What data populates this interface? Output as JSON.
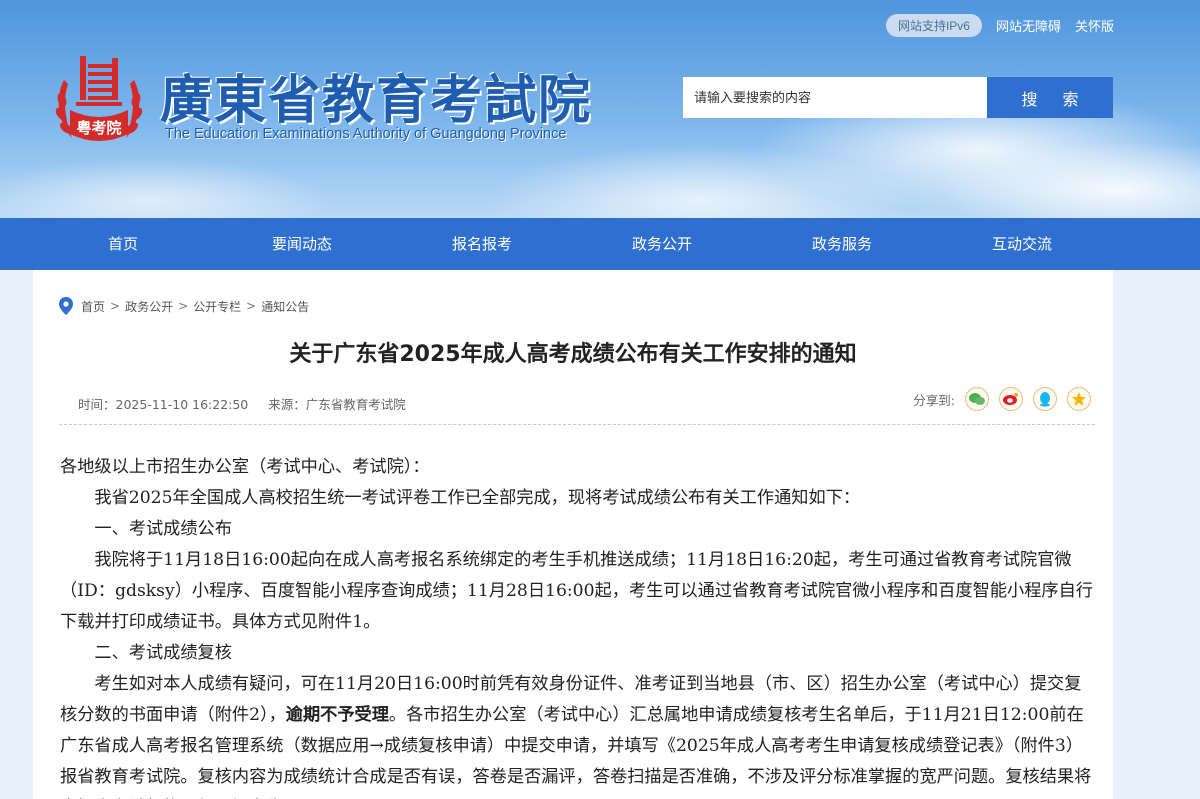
{
  "header": {
    "logo_cn": "廣東省教育考試院",
    "logo_en": "The Education Examinations Authority of Guangdong Province",
    "emblem_text": "粤考院",
    "ipv6": "网站支持IPv6",
    "accessibility": "网站无障碍",
    "care": "关怀版",
    "search": {
      "placeholder": "请输入要搜索的内容",
      "button": "搜 索"
    }
  },
  "nav": {
    "items": [
      {
        "label": "首页"
      },
      {
        "label": "要闻动态"
      },
      {
        "label": "报名报考"
      },
      {
        "label": "政务公开"
      },
      {
        "label": "政务服务"
      },
      {
        "label": "互动交流"
      }
    ]
  },
  "breadcrumb": {
    "items": [
      "首页",
      "政务公开",
      "公开专栏",
      "通知公告"
    ],
    "separator": ">"
  },
  "article": {
    "title": "关于广东省2025年成人高考成绩公布有关工作安排的通知",
    "time": "时间：2025-11-10 16:22:50",
    "source": "来源：广东省教育考试院",
    "share_label": "分享到:",
    "share_icons": [
      "wechat-icon",
      "weibo-icon",
      "qq-icon",
      "qzone-icon"
    ],
    "p0": "各地级以上市招生办公室（考试中心、考试院）：",
    "p1": "我省2025年全国成人高校招生统一考试评卷工作已全部完成，现将考试成绩公布有关工作通知如下：",
    "h1": "一、考试成绩公布",
    "p2": "我院将于11月18日16:00起向在成人高考报名系统绑定的考生手机推送成绩；11月18日16:20起，考生可通过省教育考试院官微（ID：gdsksy）小程序、百度智能小程序查询成绩；11月28日16:00起，考生可以通过省教育考试院官微小程序和百度智能小程序自行下载并打印成绩证书。具体方式见附件1。",
    "h2": "二、考试成绩复核",
    "p3a": "考生如对本人成绩有疑问，可在11月20日16:00时前凭有效身份证件、准考证到当地县（市、区）招生办公室（考试中心）提交复核分数的书面申请（附件2），",
    "p3b": "逾期不予受理",
    "p3c": "。各市招生办公室（考试中心）汇总属地申请成绩复核考生名单后，于11月21日12:00前在广东省成人高考报名管理系统（数据应用→成绩复核申请）中提交申请，并填写《2025年成人高考考生申请复核成绩登记表》（附件3）报省教育考试院。复核内容为成绩统计合成是否有误，答卷是否漏评，答卷扫描是否准确，不涉及评分标准掌握的宽严问题。复核结果将由招生考试机构逐级通知考生。"
  },
  "colors": {
    "nav_bg": "#2f6fd0",
    "search_btn": "#2f6fd0",
    "logo_text": "#1f5db0",
    "emblem_red": "#d32a2a"
  }
}
